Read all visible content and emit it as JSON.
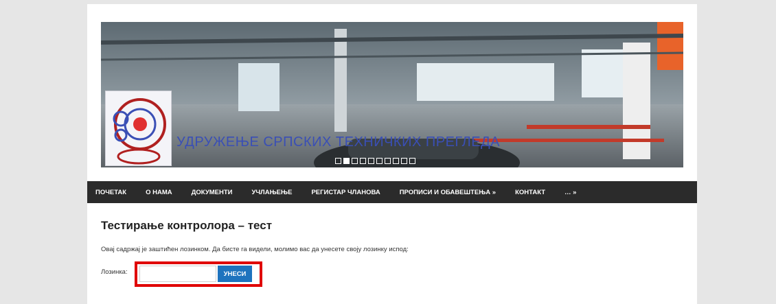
{
  "banner": {
    "heading": "УДРУЖЕЊЕ СРПСКИХ ТЕХНИЧКИХ ПРЕГЛЕДА",
    "slides_count": 10,
    "active_slide": 2
  },
  "nav": {
    "items": [
      "ПОЧЕТАК",
      "О НАМА",
      "ДОКУМЕНТИ",
      "УЧЛАЊЕЊЕ",
      "РЕГИСТАР ЧЛАНОВА",
      "ПРОПИСИ И ОБАВЕШТЕЊА »",
      "КОНТАКТ",
      "… »"
    ]
  },
  "main": {
    "title": "Тестирање контролора – тест",
    "notice": "Овај садржај је заштићен лозинком. Да бисте га видели, молимо вас да унесете своју лозинку испод:",
    "password_label": "Лозинка:",
    "password_value": "",
    "submit_label": "УНЕСИ"
  },
  "colors": {
    "page_bg": "#e6e6e6",
    "nav_bg": "#2b2b2b",
    "button": "#1e73be",
    "highlight": "#e00000"
  }
}
